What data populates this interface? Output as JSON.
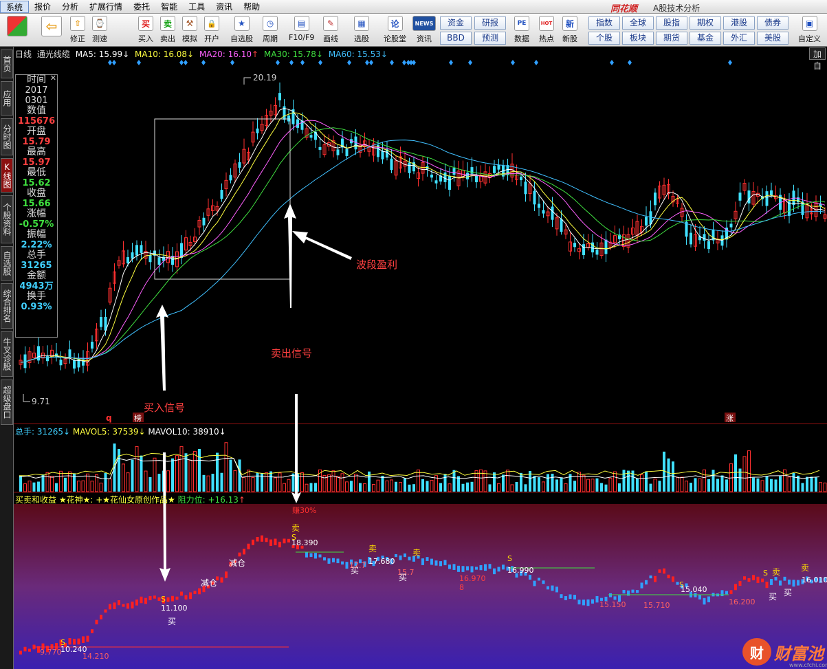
{
  "menu": {
    "items": [
      "系统",
      "报价",
      "分析",
      "扩展行情",
      "委托",
      "智能",
      "工具",
      "资讯",
      "帮助"
    ],
    "brand": "同花顺",
    "subtitle": "A股技术分析"
  },
  "toolbar": {
    "buttons": [
      {
        "label": "修正",
        "icon": "⇧"
      },
      {
        "label": "测速",
        "icon": "⌚"
      },
      {
        "label": "买入",
        "icon": "买"
      },
      {
        "label": "卖出",
        "icon": "卖"
      },
      {
        "label": "模拟",
        "icon": "⚒"
      },
      {
        "label": "开户",
        "icon": "🔒"
      },
      {
        "label": "自选股",
        "icon": "★"
      },
      {
        "label": "周期",
        "icon": "◷"
      },
      {
        "label": "F10/F9",
        "icon": "▤"
      },
      {
        "label": "画线",
        "icon": "✎"
      },
      {
        "label": "选股",
        "icon": "▦"
      },
      {
        "label": "论股堂",
        "icon": "论"
      },
      {
        "label": "资讯",
        "icon": "NEWS"
      },
      {
        "label": "数据",
        "icon": "PE"
      },
      {
        "label": "热点",
        "icon": "HOT"
      },
      {
        "label": "新股",
        "icon": "新"
      },
      {
        "label": "自定义",
        "icon": "▣"
      }
    ],
    "grid": [
      "资金",
      "研报",
      "BBD",
      "预测",
      "指数",
      "全球",
      "股指",
      "期权",
      "港股",
      "债券",
      "个股",
      "板块",
      "期货",
      "基金",
      "外汇",
      "美股"
    ]
  },
  "side_tabs": [
    "首页",
    "应用",
    "分时图",
    "K线图",
    "个股资料",
    "自选股",
    "综合排名",
    "牛叉诊股",
    "超级盘口"
  ],
  "kline": {
    "period": "日线",
    "name": "通光线缆",
    "ma": [
      {
        "label": "MA5: 15.99",
        "color": "#ffffff"
      },
      {
        "label": "MA10: 16.08",
        "color": "#ffff40"
      },
      {
        "label": "MA20: 16.10",
        "color": "#ff60ff"
      },
      {
        "label": "MA30: 15.78",
        "color": "#40e040"
      },
      {
        "label": "MA60: 15.53",
        "color": "#40c0ff"
      }
    ],
    "high_label": "20.19",
    "low_label": "9.71",
    "add_label": "加自"
  },
  "info": {
    "time_label": "时间",
    "date1": "2017",
    "date2": "0301",
    "qty_label": "数值",
    "qty": "115676",
    "open_label": "开盘",
    "open": "15.79",
    "high_label": "最高",
    "high": "15.97",
    "low_label": "最低",
    "low": "15.62",
    "close_label": "收盘",
    "close": "15.66",
    "chg_label": "涨幅",
    "chg": "-0.57%",
    "amp_label": "振幅",
    "amp": "2.22%",
    "vol_label": "总手",
    "vol": "31265",
    "amt_label": "金额",
    "amt": "4943万",
    "turn_label": "换手",
    "turn": "0.93%"
  },
  "annotations": {
    "profit": "波段盈利",
    "sell": "卖出信号",
    "buy": "买入信号",
    "bang": "榜",
    "zhang": "涨",
    "q": "q"
  },
  "volume": {
    "total": "总手: 31265",
    "mavol5": "MAVOL5: 37539",
    "mavol10": "MAVOL10: 38910"
  },
  "indicator": {
    "name": "买卖和收益",
    "tag1": "★花神★:",
    "tag2": "+★花仙女原创作品★",
    "resist": "阻力位: +16.13",
    "earn": "赚30%"
  },
  "ind_labels": {
    "sell": "卖",
    "s": "S",
    "buy": "买",
    "reduce": "减仓"
  },
  "ind_values": [
    "18.390",
    "17.680",
    "16.990",
    "16.970",
    "15.040",
    "15.710",
    "16.200",
    "16.010",
    "11.100",
    "10.240",
    "9.770",
    "18.2",
    "17.7",
    "15.7",
    "15.150",
    "8",
    "14.210"
  ],
  "watermark": {
    "logo": "财",
    "text": "财富池",
    "url": "www.cfchi.com"
  }
}
